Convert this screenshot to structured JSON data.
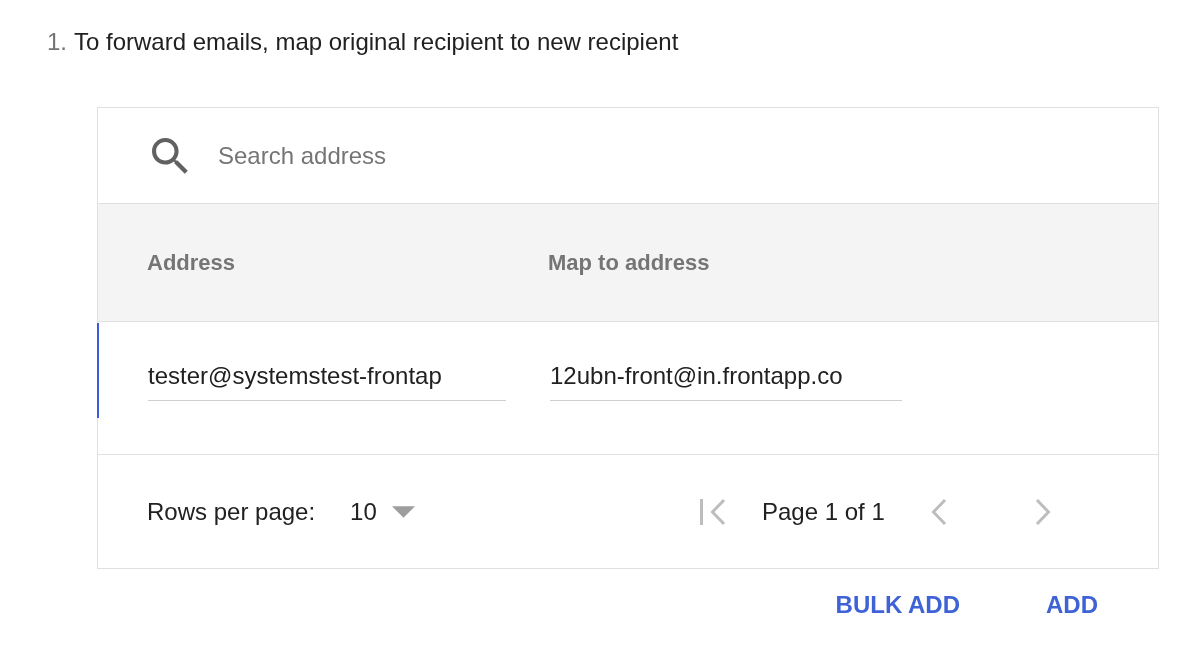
{
  "instruction": {
    "number": "1.",
    "text": "To forward emails, map original recipient to new recipient"
  },
  "search": {
    "placeholder": "Search address"
  },
  "table": {
    "columns": [
      "Address",
      "Map to address"
    ],
    "rows": [
      {
        "selected": true,
        "address": "tester@systemstest-frontap",
        "map_to_address": "12ubn-front@in.frontapp.co"
      }
    ]
  },
  "pagination": {
    "rows_per_page_label": "Rows per page:",
    "rows_per_page": "10",
    "first": {
      "disabled": true
    },
    "page_label": "Page 1 of 1",
    "previous": {
      "disabled": true
    },
    "next": {
      "disabled": true
    }
  },
  "buttons": [
    "BULK ADD",
    "ADD"
  ]
}
